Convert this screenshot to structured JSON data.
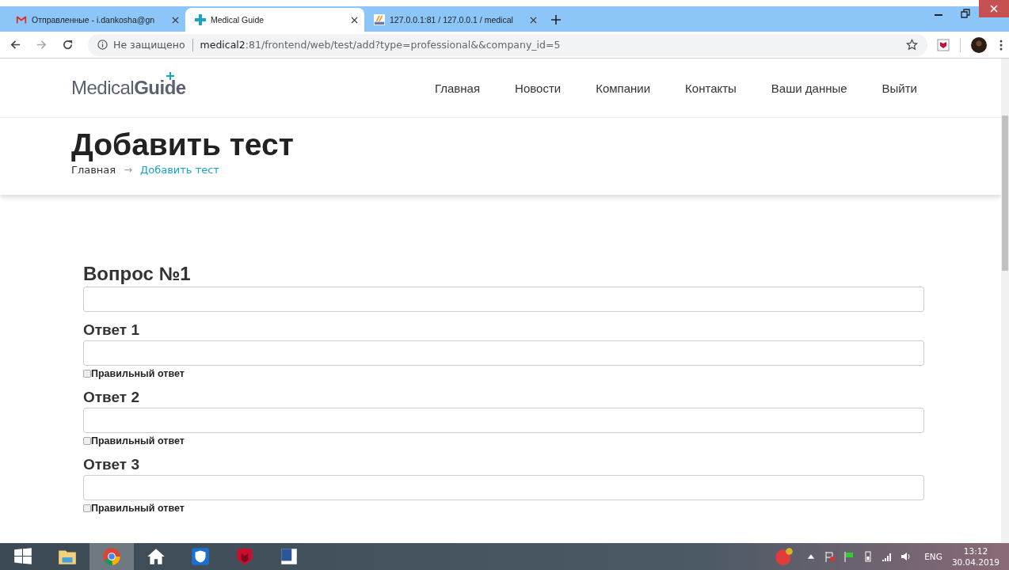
{
  "tabs": [
    {
      "title": "Отправленные - i.dankosha@gn",
      "selected": false
    },
    {
      "title": "Medical Guide",
      "selected": true
    },
    {
      "title": "127.0.0.1:81 / 127.0.0.1 / medical",
      "selected": false
    }
  ],
  "address": {
    "security": "Не защищено",
    "host": "medical2",
    "rest": ":81/frontend/web/test/add?type=professional&&company_id=5"
  },
  "site": {
    "logo": "Medical**Guide**",
    "nav": [
      "Главная",
      "Новости",
      "Компании",
      "Контакты",
      "Ваши данные",
      "Выйти"
    ]
  },
  "page": {
    "title": "Добавить тест",
    "breadcrumbs": [
      {
        "label": "Главная",
        "current": false
      },
      {
        "label": "→",
        "current": false
      },
      {
        "label": "Добавить тест",
        "current": true
      }
    ]
  },
  "form": {
    "question_label": "Вопрос №1",
    "answers": [
      {
        "label": "Ответ 1",
        "correct_label": "Правильный ответ",
        "checked": false
      },
      {
        "label": "Ответ 2",
        "correct_label": "Правильный ответ",
        "checked": false
      },
      {
        "label": "Ответ 3",
        "correct_label": "Правильный ответ",
        "checked": false
      }
    ]
  },
  "taskbar": {
    "language": "ENG",
    "time": "13:12",
    "date": "30.04.2019"
  }
}
